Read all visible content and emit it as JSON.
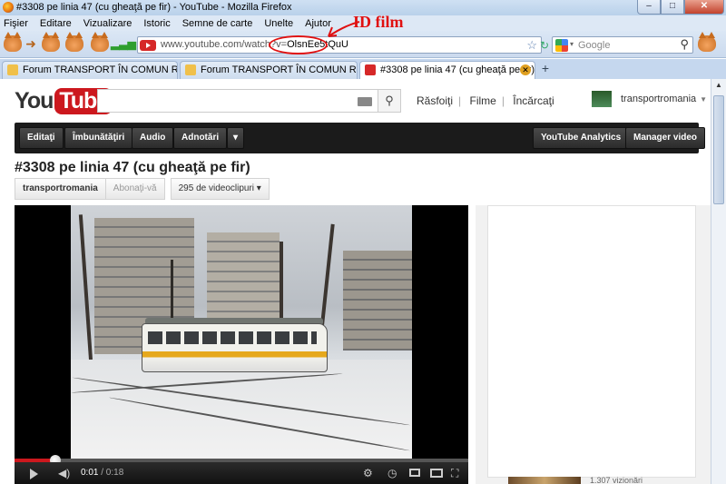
{
  "window": {
    "title": "#3308 pe linia 47 (cu gheaţă pe fir) - YouTube - Mozilla Firefox",
    "controls": [
      "–",
      "□",
      "✕"
    ]
  },
  "menu": [
    "Fişier",
    "Editare",
    "Vizualizare",
    "Istoric",
    "Semne de carte",
    "Unelte",
    "Ajutor"
  ],
  "navbar": {
    "url_prefix": "www.youtube.com/watch?v=",
    "url_id": "OlsnEe5tQuU",
    "search_placeholder": "Google"
  },
  "tabs": [
    {
      "label": "Forum TRANSPORT ÎN COMUN RO..."
    },
    {
      "label": "Forum TRANSPORT ÎN COMUN RO..."
    },
    {
      "label": "#3308 pe linia 47 (cu gheaţă pe fir)"
    }
  ],
  "annotation": {
    "label": "ID film"
  },
  "youtube": {
    "logo_you": "You",
    "logo_tube": "Tube",
    "nav": [
      "Răsfoiţi",
      "Filme",
      "Încărcaţi"
    ],
    "username": "transportromania",
    "owner_buttons": [
      "Editaţi",
      "Îmbunătăţiri",
      "Audio",
      "Adnotări",
      "▾"
    ],
    "owner_right": [
      "YouTube Analytics",
      "Manager video"
    ],
    "video_title": "#3308 pe linia 47 (cu gheaţă pe fir)",
    "channel": "transportromania",
    "subscribe": "Abonaţi-vă",
    "video_count": "295 de videoclipuri",
    "player": {
      "time_current": "0:01",
      "time_total": "/ 0:18",
      "progress": 0.09
    },
    "related_views": "1.307 vizionări"
  },
  "colors": {
    "accent": "#cc181e",
    "annotation": "#e01010"
  }
}
